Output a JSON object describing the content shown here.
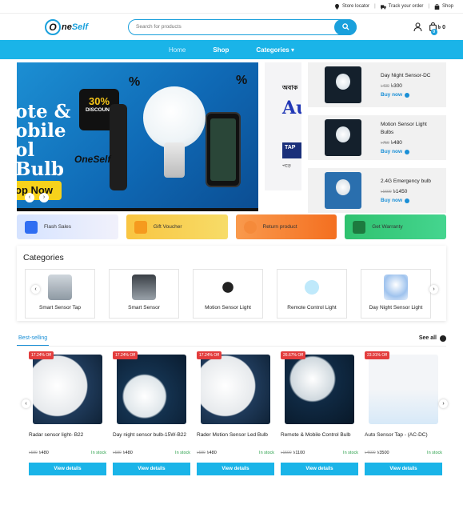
{
  "topbar": {
    "store_locator": "Store locator",
    "track_order": "Track your order",
    "shop": "Shop"
  },
  "header": {
    "logo_o": "O",
    "logo_text1": "ne",
    "logo_text2": "Self",
    "search_placeholder": "Search for products",
    "cart_count": "0",
    "cart_total": "৳ 0"
  },
  "nav": [
    "Home",
    "Shop",
    "Categories ▾"
  ],
  "hero": {
    "banner_text": "ote & obile ol Bulb",
    "discount_pct": "30%",
    "discount_word": "DISCOUNT",
    "shop_now": "op Now",
    "brand": "OneSelf",
    "side_bn": "অবাক",
    "side_au": "Au",
    "side_tap": "TAP",
    "side_tap2": "পড়ে"
  },
  "side_products": [
    {
      "name": "Day Night Sensor-DC",
      "old": "৳400",
      "price": "৳300",
      "buy": "Buy now"
    },
    {
      "name": "Motion Sensor Light Bulbs",
      "old": "৳750",
      "price": "৳480",
      "buy": "Buy now"
    },
    {
      "name": "2.4G Emergency bulb",
      "old": "৳1600",
      "price": "৳1450",
      "buy": "Buy now"
    }
  ],
  "features": [
    "Flash Sales",
    "Gift Voucher",
    "Return product",
    "Get Warranty"
  ],
  "categories": {
    "title": "Categories",
    "items": [
      "Smart Sensor Tap",
      "Smart Sensor",
      "Motion Sensor Light",
      "Remote Control Light",
      "Day Night Sensor Light"
    ]
  },
  "best_selling": {
    "title": "Best-selling",
    "see_all": "See all",
    "products": [
      {
        "off": "17.24% Off",
        "name": "Radar sensor light- B22",
        "old": "৳580",
        "price": "৳480",
        "stock": "In stock",
        "btn": "View details"
      },
      {
        "off": "17.24% Off",
        "name": "Day night sensor bulb-15W-B22",
        "old": "৳580",
        "price": "৳480",
        "stock": "In stock",
        "btn": "View details"
      },
      {
        "off": "17.24% Off",
        "name": "Rader Motion Sensor Led Bulb",
        "old": "৳580",
        "price": "৳480",
        "stock": "In stock",
        "btn": "View details"
      },
      {
        "off": "26.67% Off",
        "name": "Remote & Mobile Control Bulb",
        "old": "৳1500",
        "price": "৳1100",
        "stock": "In stock",
        "btn": "View details"
      },
      {
        "off": "23.91% Off",
        "name": "Auto Sensor Tap - (AC-DC)",
        "old": "৳4600",
        "price": "৳3500",
        "stock": "In stock",
        "btn": "View details"
      }
    ]
  },
  "colors": {
    "accent": "#1ab4e8",
    "discount": "#e33d3d",
    "stock": "#2aa14b"
  }
}
